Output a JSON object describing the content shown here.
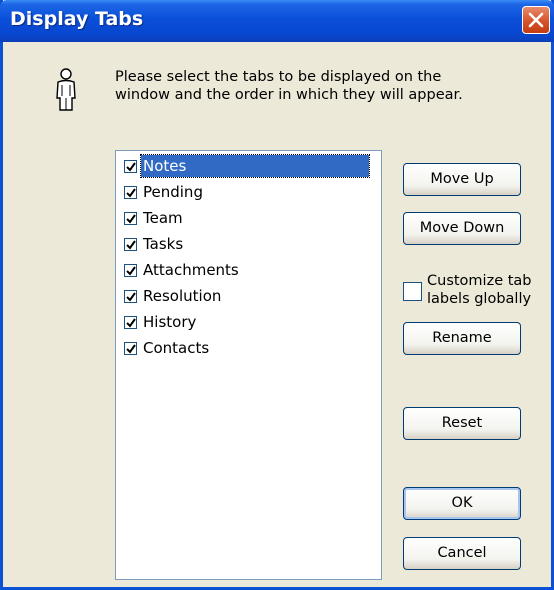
{
  "window": {
    "title": "Display Tabs"
  },
  "icons": {
    "person": "person-icon",
    "close": "close-icon",
    "check": "checkmark-icon"
  },
  "instructions": {
    "line1": "Please select the tabs to be displayed on the",
    "line2": "window and the order in which they will appear."
  },
  "tabs_list": {
    "items": [
      {
        "label": "Notes",
        "checked": true,
        "selected": true
      },
      {
        "label": "Pending",
        "checked": true,
        "selected": false
      },
      {
        "label": "Team",
        "checked": true,
        "selected": false
      },
      {
        "label": "Tasks",
        "checked": true,
        "selected": false
      },
      {
        "label": "Attachments",
        "checked": true,
        "selected": false
      },
      {
        "label": "Resolution",
        "checked": true,
        "selected": false
      },
      {
        "label": "History",
        "checked": true,
        "selected": false
      },
      {
        "label": "Contacts",
        "checked": true,
        "selected": false
      }
    ]
  },
  "buttons": {
    "move_up": "Move Up",
    "move_down": "Move Down",
    "rename": "Rename",
    "reset": "Reset",
    "ok": "OK",
    "cancel": "Cancel"
  },
  "customize": {
    "line1": "Customize tab",
    "line2": "labels globally",
    "checked": false
  },
  "colors": {
    "title_bar": "#0a4fd9",
    "selection": "#316ac5",
    "dialog_bg": "#ece9d8"
  }
}
